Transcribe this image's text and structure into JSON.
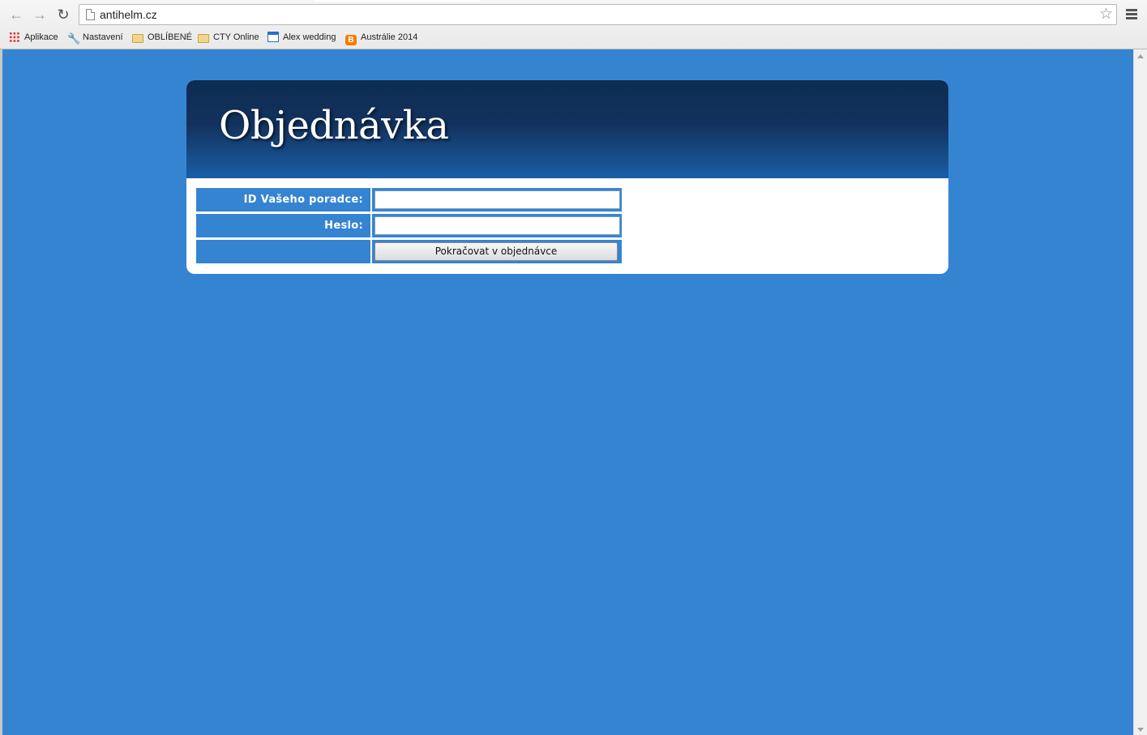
{
  "browser": {
    "url": "antihelm.cz",
    "bookmarks": [
      {
        "label": "Aplikace",
        "icon": "apps-grid-icon"
      },
      {
        "label": "Nastavení",
        "icon": "wrench-icon"
      },
      {
        "label": "OBLÍBENÉ",
        "icon": "folder-icon"
      },
      {
        "label": "CTY Online",
        "icon": "folder-icon"
      },
      {
        "label": "Alex wedding",
        "icon": "calendar-icon"
      },
      {
        "label": "Austrálie 2014",
        "icon": "blogger-icon"
      }
    ]
  },
  "page": {
    "title": "Objednávka",
    "form": {
      "advisor_id_label": "ID Vašeho poradce:",
      "advisor_id_value": "",
      "password_label": "Heslo:",
      "password_value": "",
      "submit_label": "Pokračovat v objednávce"
    }
  },
  "colors": {
    "page_background": "#3584d2",
    "header_dark": "#0e2c52",
    "header_light": "#1a5ea6",
    "label_cell": "#3584d2"
  }
}
